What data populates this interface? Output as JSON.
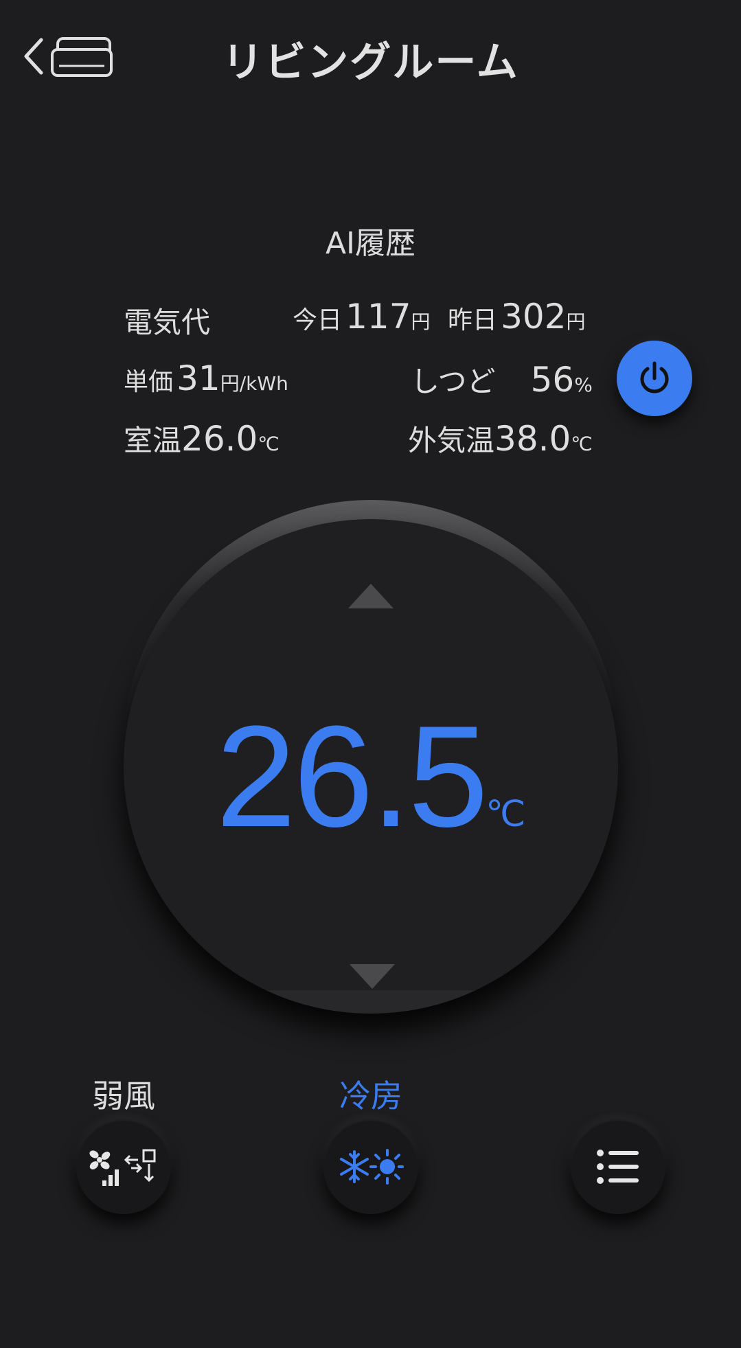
{
  "header": {
    "title": "リビングルーム"
  },
  "ai_history_label": "AI履歴",
  "info": {
    "electricity_label": "電気代",
    "today_label": "今日",
    "today_value": "117",
    "today_unit": "円",
    "yesterday_label": "昨日",
    "yesterday_value": "302",
    "yesterday_unit": "円",
    "unit_price_label": "単価",
    "unit_price_value": "31",
    "unit_price_unit": "円/kWh",
    "humidity_label": "しつど",
    "humidity_value": "56",
    "humidity_unit": "%",
    "room_temp_label": "室温",
    "room_temp_value": "26.0",
    "room_temp_unit": "℃",
    "outdoor_temp_label": "外気温",
    "outdoor_temp_value": "38.0",
    "outdoor_temp_unit": "℃"
  },
  "thermostat": {
    "set_temp": "26.5",
    "unit": "℃"
  },
  "controls": {
    "fan_label": "弱風",
    "mode_label": "冷房",
    "menu_icon": "list-icon"
  },
  "colors": {
    "accent": "#3b7cf0",
    "background": "#1d1d1f"
  }
}
